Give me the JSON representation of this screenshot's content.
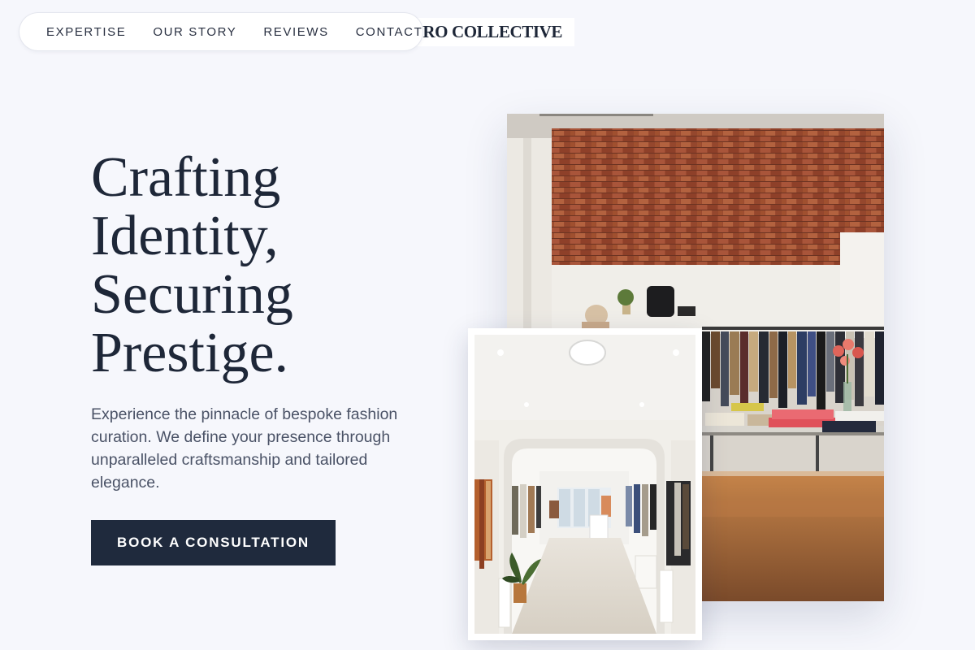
{
  "nav": {
    "links": [
      "EXPERTISE",
      "OUR STORY",
      "REVIEWS",
      "CONTACT"
    ]
  },
  "brand": {
    "name": "KURO COLLECTIVE"
  },
  "hero": {
    "title_lines": [
      "Crafting",
      "Identity,",
      "Securing",
      "Prestige."
    ],
    "description": "Experience the pinnacle of bespoke fashion curation. We define your presence through unparalleled craftsmanship and tailored elegance.",
    "cta_label": "BOOK A CONSULTATION"
  },
  "images": {
    "primary": "store-interior-photo",
    "secondary": "boutique-corridor-photo"
  },
  "colors": {
    "background": "#f6f7fc",
    "ink": "#1e2738",
    "cta": "#1f2a3d",
    "body_text": "#4a5266"
  }
}
